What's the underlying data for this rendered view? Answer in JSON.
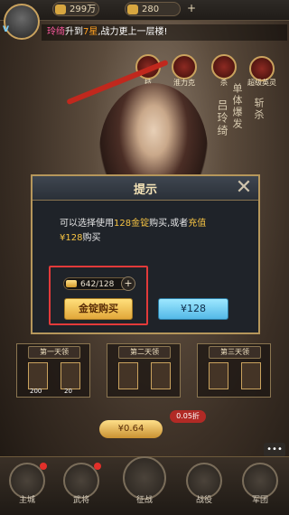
{
  "topbar": {
    "gold": "299万",
    "ingots": "280",
    "plus": "+"
  },
  "ticker": {
    "name": "玲绮",
    "text1": "升到",
    "stars": "7星",
    "text2": ",战力更上一层楼!"
  },
  "skills": [
    {
      "label": "技"
    },
    {
      "label": "淮力克"
    },
    {
      "label": "杀"
    },
    {
      "label": "超级英灵"
    }
  ],
  "side_text": [
    "单体爆发",
    "斩杀"
  ],
  "hero_name": "吕玲绮",
  "dialog": {
    "title": "提示",
    "msg_a": "可以选择使用",
    "msg_b": "128金锭",
    "msg_c": "购买,或者",
    "msg_d": "充值",
    "msg_e": "¥128",
    "msg_f": "购买",
    "ingot_count": "642/128",
    "buy_ingot_label": "金锭购买",
    "buy_cash_label": "¥128"
  },
  "days": [
    {
      "label": "第一天领",
      "items": [
        "200",
        "20"
      ]
    },
    {
      "label": "第二天领",
      "items": [
        "",
        ""
      ]
    },
    {
      "label": "第三天领",
      "items": [
        "",
        ""
      ]
    }
  ],
  "price_button": "¥0.64",
  "discount": "0.05折",
  "nav": [
    {
      "label": "主城"
    },
    {
      "label": "武将"
    },
    {
      "label": "征战"
    },
    {
      "label": "战役"
    },
    {
      "label": "军团"
    }
  ]
}
